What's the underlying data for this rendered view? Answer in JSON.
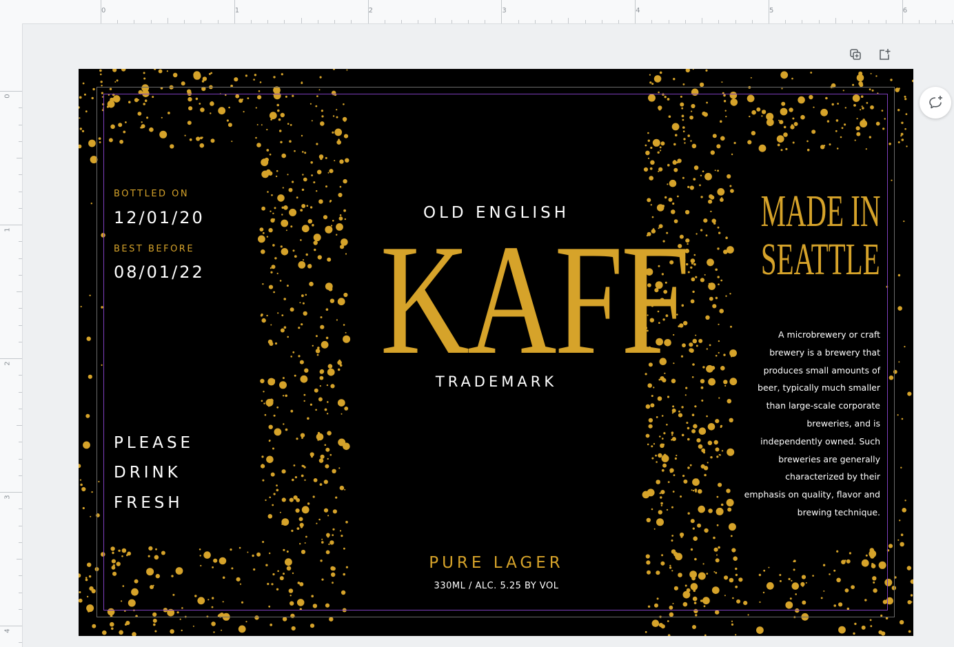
{
  "ruler": {
    "top_marks": [
      "0",
      "1",
      "2",
      "3",
      "4",
      "5",
      "6"
    ],
    "left_marks": [
      "0",
      "1",
      "2",
      "3",
      "4"
    ]
  },
  "toolbar": {
    "duplicate_icon": "duplicate-page-icon",
    "add_page_icon": "add-page-icon",
    "comment_icon": "add-comment-icon"
  },
  "label": {
    "bottled_on_label": "BOTTLED ON",
    "bottled_on_date": "12/01/20",
    "best_before_label": "BEST BEFORE",
    "best_before_date": "08/01/22",
    "drink_line1": "PLEASE",
    "drink_line2": "DRINK",
    "drink_line3": "FRESH",
    "old_english": "OLD ENGLISH",
    "brand": "KAFF",
    "trademark": "TRADEMARK",
    "pure_lager": "PURE LAGER",
    "volume": "330ML / ALC. 5.25 BY VOL",
    "made_in_line1": "MADE IN",
    "made_in_line2": "SEATTLE",
    "description": "A microbrewery or craft brewery is a brewery that produces small amounts of beer, typically much smaller than large-scale corporate breweries, and is independently owned. Such breweries are generally characterized by their emphasis on quality, flavor and brewing technique."
  },
  "colors": {
    "background": "#000000",
    "gold": "#d6a32a",
    "text": "#ffffff",
    "guide": "#7f3fbf",
    "canvas_bg": "#eef0f2"
  }
}
